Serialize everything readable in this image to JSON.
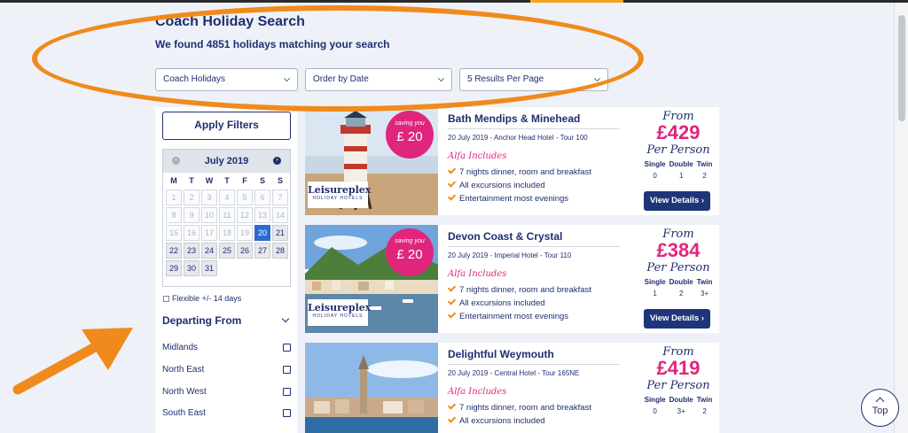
{
  "header": {
    "title": "Coach Holiday Search",
    "subtitle": "We found 4851 holidays matching your search"
  },
  "filters": {
    "category": "Coach Holidays",
    "order": "Order by Date",
    "per_page": "5 Results Per Page"
  },
  "sidebar": {
    "apply_label": "Apply Filters",
    "calendar": {
      "month": "July 2019",
      "days_of_week": [
        "M",
        "T",
        "W",
        "T",
        "F",
        "S",
        "S"
      ],
      "days": [
        "1",
        "2",
        "3",
        "4",
        "5",
        "6",
        "7",
        "8",
        "9",
        "10",
        "11",
        "12",
        "13",
        "14",
        "15",
        "16",
        "17",
        "18",
        "19",
        "20",
        "21",
        "22",
        "23",
        "24",
        "25",
        "26",
        "27",
        "28",
        "29",
        "30",
        "31"
      ],
      "selected_day": "20"
    },
    "flexible_label": "Flexible +/- 14 days",
    "departing_title": "Departing From",
    "regions": [
      "Midlands",
      "North East",
      "North West",
      "South East"
    ]
  },
  "results": [
    {
      "title": "Bath Mendips & Minehead",
      "meta": "20 July 2019 - Anchor Head Hotel - Tour 100",
      "saving_label": "saving you",
      "saving": "£ 20",
      "brand": "Leisureplex",
      "brand_sub": "HOLIDAY HOTELS",
      "alfa": "Alfa Includes",
      "includes": [
        "7 nights dinner, room and breakfast",
        "All excursions included",
        "Entertainment most evenings"
      ],
      "from": "From",
      "price": "£429",
      "per_person": "Per Person",
      "occupancy": {
        "single_label": "Single",
        "double_label": "Double",
        "twin_label": "Twin",
        "single": "0",
        "double": "1",
        "twin": "2"
      },
      "button": "View Details ›"
    },
    {
      "title": "Devon Coast & Crystal",
      "meta": "20 July 2019 - Imperial Hotel - Tour 110",
      "saving_label": "saving you",
      "saving": "£ 20",
      "brand": "Leisureplex",
      "brand_sub": "HOLIDAY HOTELS",
      "alfa": "Alfa Includes",
      "includes": [
        "7 nights dinner, room and breakfast",
        "All excursions included",
        "Entertainment most evenings"
      ],
      "from": "From",
      "price": "£384",
      "per_person": "Per Person",
      "occupancy": {
        "single_label": "Single",
        "double_label": "Double",
        "twin_label": "Twin",
        "single": "1",
        "double": "2",
        "twin": "3+"
      },
      "button": "View Details ›"
    },
    {
      "title": "Delightful Weymouth",
      "meta": "20 July 2019 - Central Hotel - Tour 165NE",
      "alfa": "Alfa Includes",
      "includes": [
        "7 nights dinner, room and breakfast",
        "All excursions included"
      ],
      "from": "From",
      "price": "£419",
      "per_person": "Per Person",
      "occupancy": {
        "single_label": "Single",
        "double_label": "Double",
        "twin_label": "Twin",
        "single": "0",
        "double": "3+",
        "twin": "2"
      }
    }
  ],
  "top_button": "Top",
  "colors": {
    "navy": "#1f2f6f",
    "pink": "#e0257d",
    "orange": "#f08a1c",
    "button": "#1f3579"
  }
}
